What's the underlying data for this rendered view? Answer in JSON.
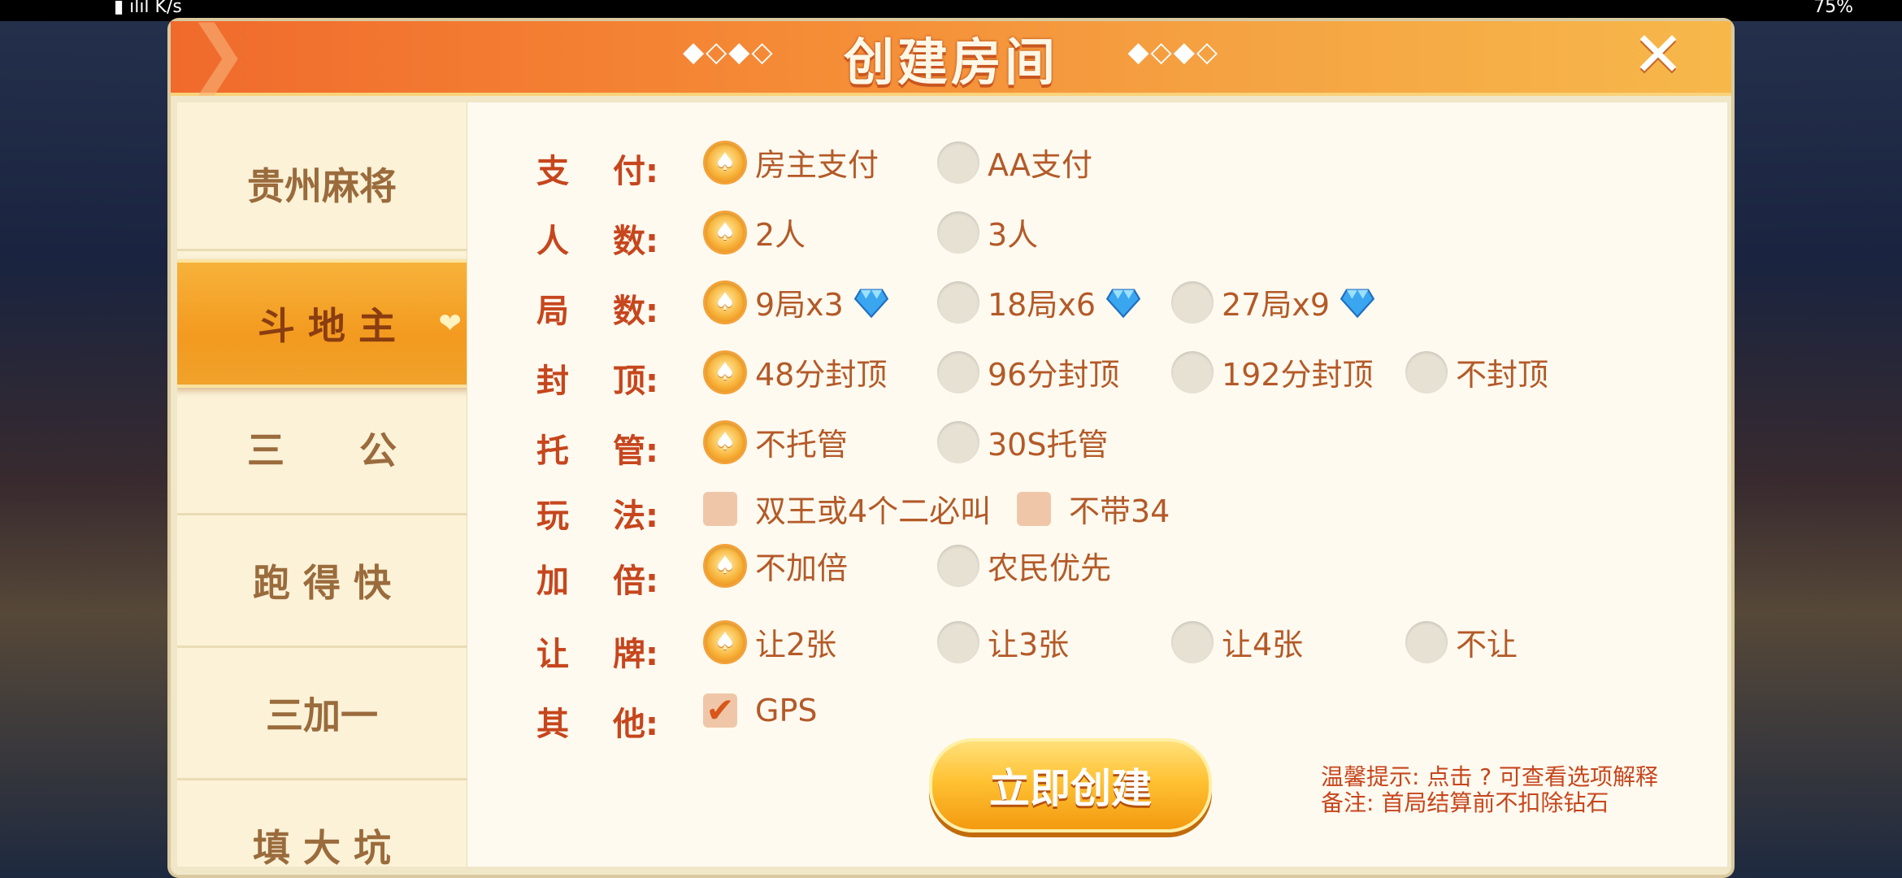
{
  "header": {
    "title": "创建房间",
    "left_dots": "◆◇◆◇",
    "right_dots": "◆◇◆◇"
  },
  "status_bar": {
    "left": "▮ ılıl K/s",
    "right": "75%"
  },
  "sidebar": {
    "items": [
      {
        "label": "贵州麻将",
        "active": false
      },
      {
        "label": "斗 地 主",
        "active": true
      },
      {
        "label": "三　　公",
        "active": false
      },
      {
        "label": "跑 得 快",
        "active": false
      },
      {
        "label": "三加一",
        "active": false
      },
      {
        "label": "填 大 坑",
        "active": false
      }
    ]
  },
  "rows": [
    {
      "label_a": "支",
      "label_b": "付:",
      "type": "radio",
      "options": [
        {
          "text": "房主支付",
          "selected": true
        },
        {
          "text": "AA支付",
          "selected": false
        }
      ]
    },
    {
      "label_a": "人",
      "label_b": "数:",
      "type": "radio",
      "options": [
        {
          "text": "2人",
          "selected": true
        },
        {
          "text": "3人",
          "selected": false
        }
      ]
    },
    {
      "label_a": "局",
      "label_b": "数:",
      "type": "radio",
      "options": [
        {
          "text": "9局x3",
          "selected": true,
          "gem": true
        },
        {
          "text": "18局x6",
          "selected": false,
          "gem": true
        },
        {
          "text": "27局x9",
          "selected": false,
          "gem": true
        }
      ]
    },
    {
      "label_a": "封",
      "label_b": "顶:",
      "type": "radio",
      "options": [
        {
          "text": "48分封顶",
          "selected": true
        },
        {
          "text": "96分封顶",
          "selected": false
        },
        {
          "text": "192分封顶",
          "selected": false
        },
        {
          "text": "不封顶",
          "selected": false
        }
      ]
    },
    {
      "label_a": "托",
      "label_b": "管:",
      "type": "radio",
      "options": [
        {
          "text": "不托管",
          "selected": true
        },
        {
          "text": "30S托管",
          "selected": false
        }
      ]
    },
    {
      "label_a": "玩",
      "label_b": "法:",
      "type": "checkbox",
      "options": [
        {
          "text": "双王或4个二必叫",
          "checked": false
        },
        {
          "text": "不带34",
          "checked": false
        }
      ]
    },
    {
      "label_a": "加",
      "label_b": "倍:",
      "type": "radio",
      "options": [
        {
          "text": "不加倍",
          "selected": true
        },
        {
          "text": "农民优先",
          "selected": false
        }
      ]
    },
    {
      "label_a": "让",
      "label_b": "牌:",
      "type": "radio",
      "options": [
        {
          "text": "让2张",
          "selected": true
        },
        {
          "text": "让3张",
          "selected": false
        },
        {
          "text": "让4张",
          "selected": false
        },
        {
          "text": "不让",
          "selected": false
        }
      ]
    },
    {
      "label_a": "其",
      "label_b": "他:",
      "type": "checkbox",
      "options": [
        {
          "text": "GPS",
          "checked": true
        }
      ]
    }
  ],
  "create_button": {
    "label": "立即创建"
  },
  "tips": {
    "line1": "温馨提示: 点击 ? 可查看选项解释",
    "line2": "备注: 首局结算前不扣除钻石"
  },
  "colors": {
    "accent": "#f39a1f",
    "label": "#c6461d",
    "option": "#b35a28"
  }
}
